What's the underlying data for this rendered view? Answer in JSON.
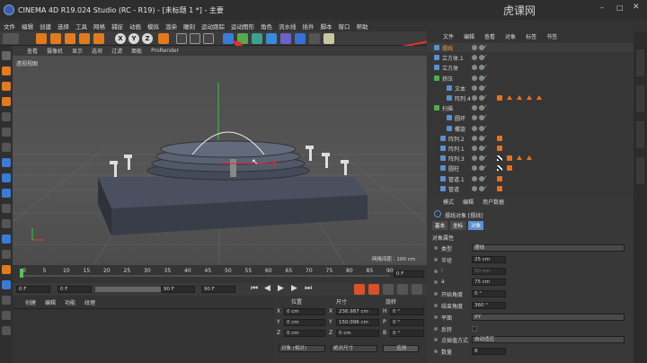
{
  "titlebar": {
    "title": "CINEMA 4D R19.024 Studio (RC - R19) - [未标题 1 *] - 主要",
    "watermark": "虎课网"
  },
  "menu": [
    "文件",
    "编辑",
    "创建",
    "选择",
    "工具",
    "网格",
    "捕捉",
    "动画",
    "模拟",
    "渲染",
    "雕刻",
    "运动跟踪",
    "运动图形",
    "角色",
    "流水线",
    "插件",
    "脚本",
    "窗口",
    "帮助"
  ],
  "toolbar": {
    "xyz": [
      "X",
      "Y",
      "Z"
    ]
  },
  "viewport": {
    "menu": [
      "查看",
      "摄像机",
      "显示",
      "选项",
      "过滤",
      "面板",
      "ProRender"
    ],
    "label": "透视视图",
    "grid_text": "网格间距 : 100 cm"
  },
  "timeline": {
    "ticks": [
      "0",
      "5",
      "10",
      "15",
      "20",
      "25",
      "30",
      "35",
      "40",
      "45",
      "50",
      "55",
      "60",
      "65",
      "70",
      "75",
      "80",
      "85",
      "90"
    ],
    "frame_field": "0 F"
  },
  "playbar": {
    "start": "0 F",
    "current": "0 F",
    "end": "90 F",
    "end2": "90 F"
  },
  "materials": {
    "tabs": [
      "创建",
      "编辑",
      "功能",
      "纹理"
    ]
  },
  "coords": {
    "headers": [
      "位置",
      "尺寸",
      "旋转"
    ],
    "rows": [
      {
        "axis": "X",
        "pos": "0 cm",
        "size": "236.987 cm",
        "rlabel": "H",
        "rot": "0 °"
      },
      {
        "axis": "Y",
        "pos": "0 cm",
        "size": "150.096 cm",
        "rlabel": "P",
        "rot": "0 °"
      },
      {
        "axis": "Z",
        "pos": "0 cm",
        "size": "0 cm",
        "rlabel": "B",
        "rot": "0 °"
      }
    ],
    "mode": "对象 (相对)",
    "size_mode": "绝对尺寸",
    "apply": "应用"
  },
  "objects": {
    "tabs": [
      "文件",
      "编辑",
      "查看",
      "对象",
      "标签",
      "书签"
    ],
    "items": [
      "摆线",
      "立方体.1",
      "立方体",
      "挤压",
      "文本",
      "阵列.4",
      "扫描",
      "圆环",
      "螺旋",
      "阵列.2",
      "阵列.1",
      "阵列.3",
      "圆柱",
      "管道.1",
      "管道"
    ]
  },
  "attributes": {
    "tabs": [
      "模式",
      "编辑",
      "用户数据"
    ],
    "object": "摆线对象 [摆线]",
    "subtabs": [
      "基本",
      "坐标",
      "对象"
    ],
    "section": "对象属性",
    "props": [
      {
        "label": "类型",
        "value": "摆线"
      },
      {
        "label": "半径",
        "value": "25 cm"
      },
      {
        "label": "r",
        "value": "50 cm"
      },
      {
        "label": "a",
        "value": "75 cm"
      },
      {
        "label": "开始角度",
        "value": "0 °"
      },
      {
        "label": "结束角度",
        "value": "360 °"
      },
      {
        "label": "平面",
        "value": "XY"
      },
      {
        "label": "反转",
        "value": ""
      },
      {
        "label": "点插值方式",
        "value": "自动适应"
      },
      {
        "label": "数量",
        "value": "8"
      }
    ]
  },
  "colors": {
    "accent": "#e87020",
    "blue": "#5a8fd0",
    "green": "#4caf50",
    "arrow": "#e0342c"
  }
}
